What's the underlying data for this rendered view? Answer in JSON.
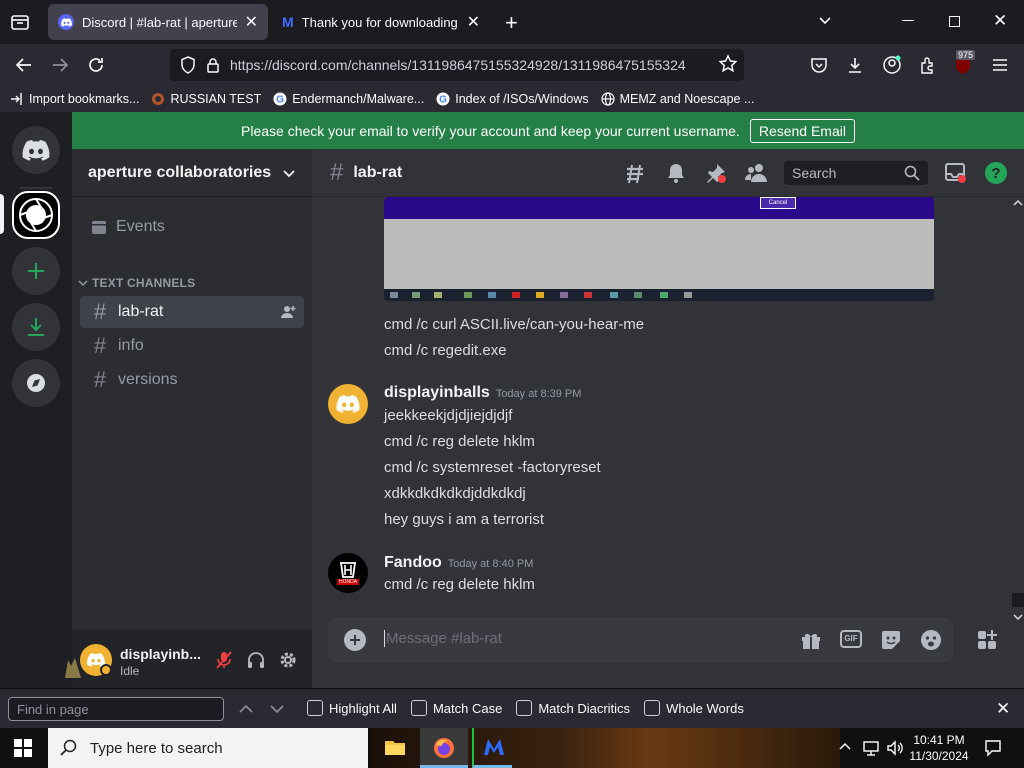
{
  "browser": {
    "tabs": [
      {
        "title": "Discord | #lab-rat | aperture coll",
        "active": true
      },
      {
        "title": "Thank you for downloading Ma",
        "active": false
      }
    ],
    "url": "https://discord.com/channels/1311986475155324928/1311986475155324",
    "extension_badge": "975",
    "bookmarks": [
      {
        "label": "Import bookmarks...",
        "icon": "import-icon"
      },
      {
        "label": "RUSSIAN TEST",
        "icon": "github-icon"
      },
      {
        "label": "Endermanch/Malware...",
        "icon": "google-icon"
      },
      {
        "label": "Index of /ISOs/Windows",
        "icon": "google-icon"
      },
      {
        "label": "MEMZ and Noescape ...",
        "icon": "globe-icon"
      }
    ]
  },
  "banner": {
    "text": "Please check your email to verify your account and keep your current username.",
    "button": "Resend Email"
  },
  "server": {
    "name": "aperture collaboratories",
    "events_label": "Events",
    "category": "TEXT CHANNELS",
    "channels": [
      {
        "name": "lab-rat",
        "selected": true
      },
      {
        "name": "info",
        "selected": false
      },
      {
        "name": "versions",
        "selected": false
      }
    ]
  },
  "user": {
    "name": "displayinb...",
    "status": "Idle"
  },
  "chat": {
    "channel": "lab-rat",
    "search_placeholder": "Search",
    "image_button": "Cancel",
    "messages_top": [
      "cmd /c curl ASCII.live/can-you-hear-me",
      "cmd /c regedit.exe"
    ],
    "groups": [
      {
        "author": "displayinballs",
        "timestamp": "Today at 8:39 PM",
        "lines": [
          "jeekkeekjdjdjiejdjdjf",
          "cmd /c reg delete hklm",
          "cmd /c systemreset -factoryreset",
          "xdkkdkdkdkdjddkdkdj",
          "hey guys i am a terrorist"
        ]
      },
      {
        "author": "Fandoo",
        "timestamp": "Today at 8:40 PM",
        "lines": [
          "cmd /c reg delete hklm"
        ],
        "avatar_text": "HONDA"
      }
    ],
    "composer_placeholder": "Message #lab-rat"
  },
  "findbar": {
    "placeholder": "Find in page",
    "options": [
      "Highlight All",
      "Match Case",
      "Match Diacritics",
      "Whole Words"
    ]
  },
  "taskbar": {
    "search_placeholder": "Type here to search",
    "time": "10:41 PM",
    "date": "11/30/2024"
  },
  "colors": {
    "discord_blurple": "#5865f2",
    "green": "#248046",
    "idle": "#f0b232",
    "avatar_yellow": "#f0b232"
  }
}
